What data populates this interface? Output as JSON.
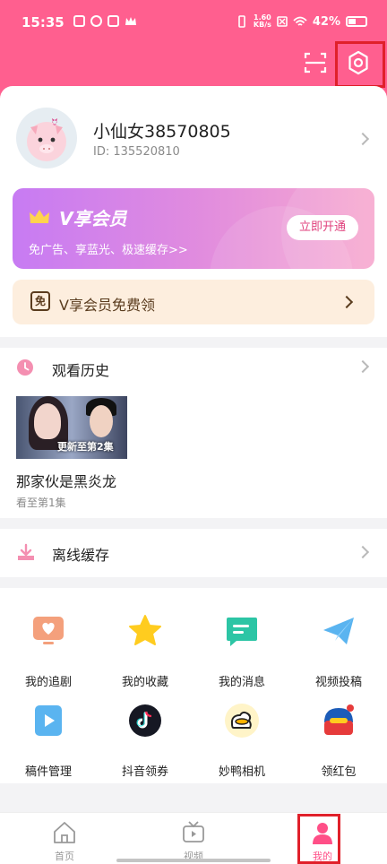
{
  "status_bar": {
    "time": "15:35",
    "battery": "42%",
    "speed_top": "1.60",
    "speed_bottom": "KB/s"
  },
  "profile": {
    "username": "小仙女38570805",
    "user_id": "ID: 135520810"
  },
  "vip_banner": {
    "title": "V享会员",
    "subtitle": "免广告、享蓝光、极速缓存>>",
    "button": "立即开通"
  },
  "free_vip": {
    "badge": "免",
    "label": "V享会员免费领"
  },
  "history": {
    "title": "观看历史",
    "item": {
      "thumbnail_caption": "更新至第2集",
      "title": "那家伙是黑炎龙",
      "progress": "看至第1集"
    }
  },
  "offline": {
    "title": "离线缓存"
  },
  "grid": [
    {
      "label": "我的追剧",
      "icon": "tv-heart-icon"
    },
    {
      "label": "我的收藏",
      "icon": "star-icon"
    },
    {
      "label": "我的消息",
      "icon": "message-icon"
    },
    {
      "label": "视频投稿",
      "icon": "paper-plane-icon"
    },
    {
      "label": "稿件管理",
      "icon": "play-document-icon"
    },
    {
      "label": "抖音领券",
      "icon": "tiktok-icon"
    },
    {
      "label": "妙鸭相机",
      "icon": "duck-camera-icon"
    },
    {
      "label": "领红包",
      "icon": "red-packet-icon"
    }
  ],
  "tabs": [
    {
      "label": "首页",
      "icon": "home-icon"
    },
    {
      "label": "视频",
      "icon": "tv-icon"
    },
    {
      "label": "我的",
      "icon": "person-icon",
      "active": true
    }
  ],
  "colors": {
    "brand": "#ff5f8f",
    "highlight_box": "#e0202a"
  }
}
